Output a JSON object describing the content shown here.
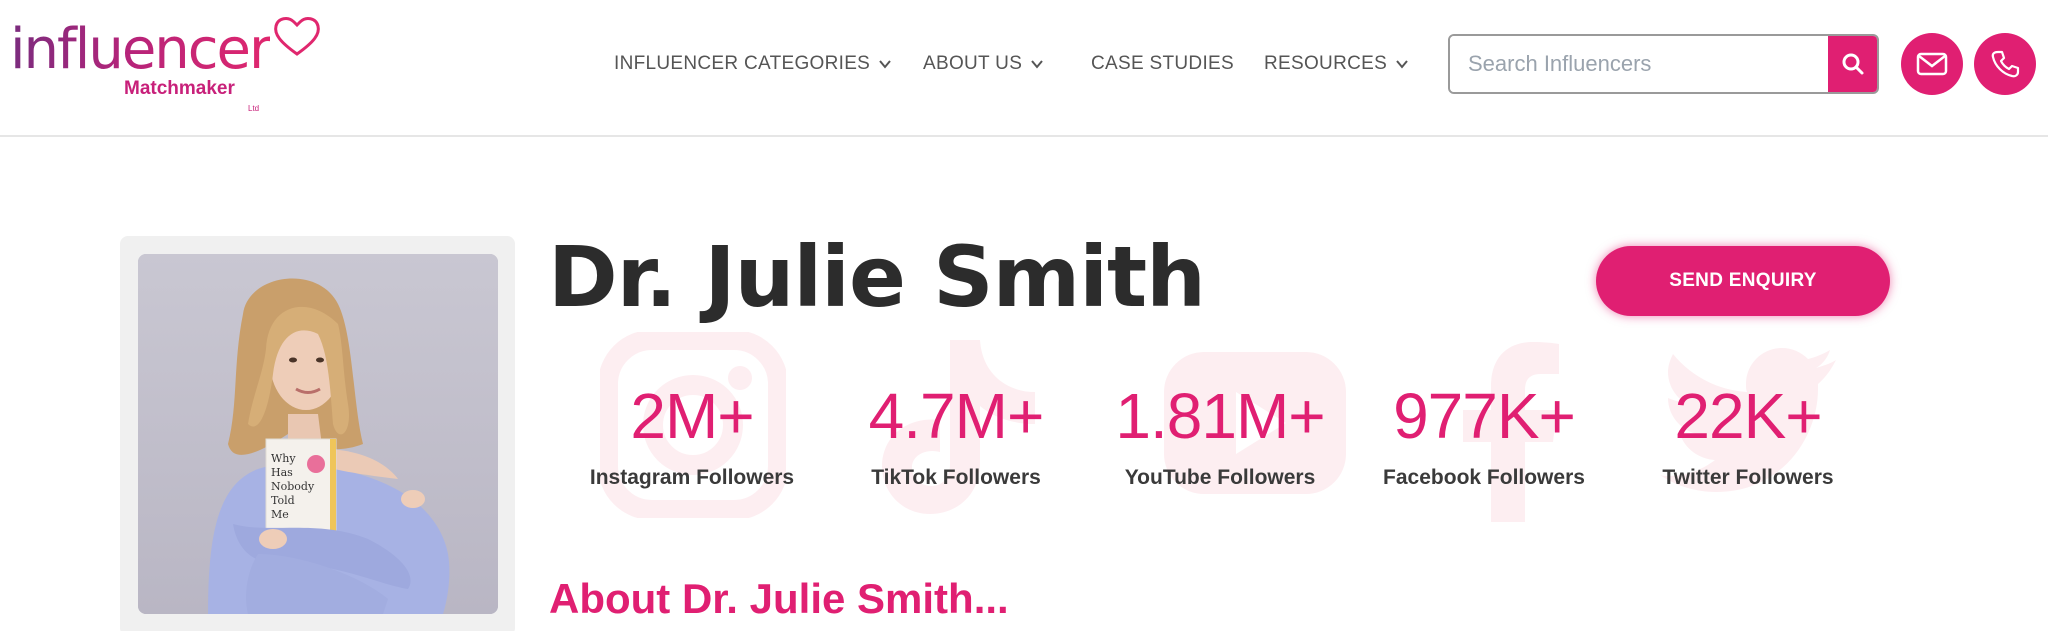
{
  "logo": {
    "word": "influencer",
    "sub": "Matchmaker",
    "ltd": "Ltd"
  },
  "nav": {
    "items": [
      {
        "label": "INFLUENCER CATEGORIES",
        "has_dropdown": true
      },
      {
        "label": "ABOUT US",
        "has_dropdown": true
      },
      {
        "label": "CASE STUDIES",
        "has_dropdown": false
      },
      {
        "label": "RESOURCES",
        "has_dropdown": true
      }
    ]
  },
  "search": {
    "placeholder": "Search Influencers",
    "value": ""
  },
  "header_icons": [
    "search-icon",
    "mail-icon",
    "phone-icon"
  ],
  "profile": {
    "name": "Dr. Julie Smith",
    "enquiry_label": "SEND ENQUIRY",
    "book_text": [
      "Why",
      "Has",
      "Nobody",
      "Told",
      "Me"
    ],
    "about_heading": "About Dr. Julie Smith..."
  },
  "stats": [
    {
      "value": "2M+",
      "label": "Instagram Followers",
      "icon": "instagram-icon"
    },
    {
      "value": "4.7M+",
      "label": "TikTok Followers",
      "icon": "tiktok-icon"
    },
    {
      "value": "1.81M+",
      "label": "YouTube Followers",
      "icon": "youtube-icon"
    },
    {
      "value": "977K+",
      "label": "Facebook Followers",
      "icon": "facebook-icon"
    },
    {
      "value": "22K+",
      "label": "Twitter Followers",
      "icon": "twitter-icon"
    }
  ],
  "colors": {
    "accent": "#e01f72",
    "text_dark": "#2c2c2c",
    "nav_text": "#555555",
    "watermark": "#fdeef1"
  }
}
